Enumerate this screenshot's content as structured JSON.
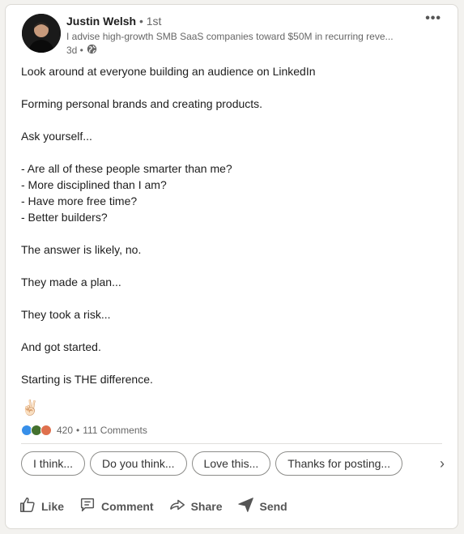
{
  "author": {
    "name": "Justin Welsh",
    "degree": "• 1st",
    "headline": "I advise high-growth SMB SaaS companies toward $50M in recurring reve...",
    "time": "3d •"
  },
  "menu_label": "•••",
  "post": {
    "lines": [
      "Look around at everyone building an audience on LinkedIn",
      "",
      "Forming personal brands and creating products.",
      "",
      "Ask yourself...",
      "",
      "- Are all of these people smarter than me?",
      "- More disciplined than I am?",
      "- Have more free time?",
      "- Better builders?",
      "",
      "The answer is likely, no.",
      "",
      "They made a plan...",
      "",
      "They took a risk...",
      "",
      "And got started.",
      "",
      "Starting is THE difference."
    ],
    "emoji": "✌🏻"
  },
  "social": {
    "reactions_count": "420",
    "separator": "•",
    "comments": "111 Comments"
  },
  "suggestions": [
    "I think...",
    "Do you think...",
    "Love this...",
    "Thanks for posting..."
  ],
  "actions": {
    "like": "Like",
    "comment": "Comment",
    "share": "Share",
    "send": "Send"
  },
  "colors": {
    "like_blue": "#378fe9",
    "celebrate_green": "#44712e",
    "love_red": "#df704d"
  }
}
